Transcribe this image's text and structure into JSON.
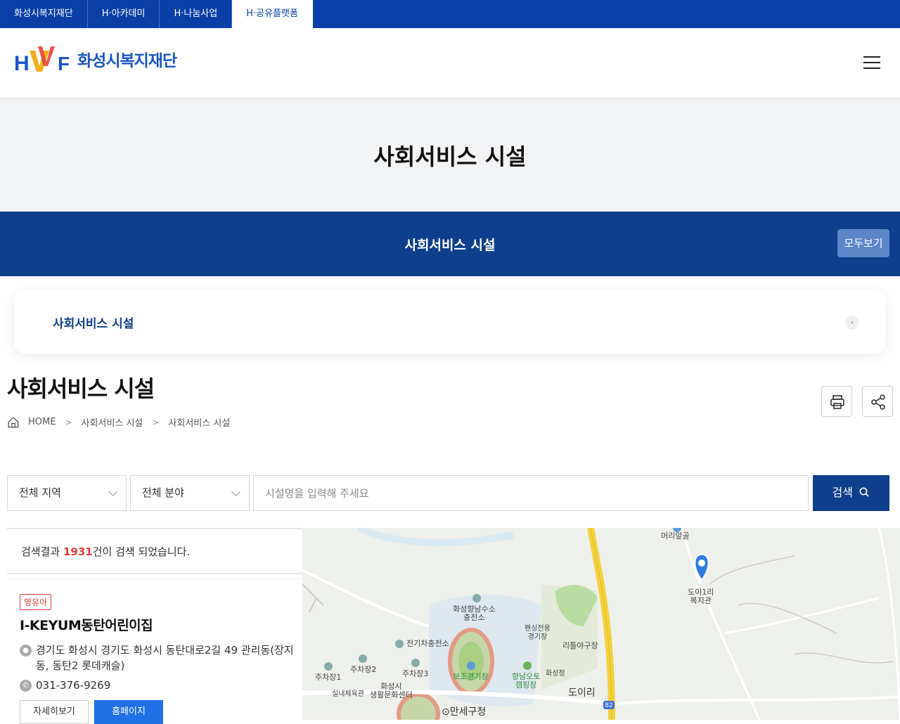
{
  "topbar": {
    "tabs": [
      {
        "label": "화성시복지재단",
        "active": false
      },
      {
        "label": "H·아카데미",
        "active": false
      },
      {
        "label": "H·나눔사업",
        "active": false
      },
      {
        "label": "H·공유플랫폼",
        "active": true
      }
    ]
  },
  "header": {
    "logo_text": "화성시복지재단",
    "menu_icon": "hamburger-icon"
  },
  "hero": {
    "title": "사회서비스 시설"
  },
  "band": {
    "title": "사회서비스 시설",
    "all_button": "모두보기"
  },
  "submenu": {
    "label": "사회서비스 시설"
  },
  "page": {
    "title": "사회서비스 시설",
    "breadcrumb": [
      "HOME",
      "사회서비스 시설",
      "사회서비스 시설"
    ]
  },
  "search": {
    "region_select": "전체 지역",
    "field_select": "전체 분야",
    "placeholder": "시설명을 입력해 주세요",
    "button_label": "검색"
  },
  "results": {
    "count_prefix": "검색결과 ",
    "count": "1931",
    "count_suffix": "건이 검색 되었습니다.",
    "items": [
      {
        "badge": "영유아",
        "name": "I-KEYUM동탄어린이집",
        "address": "경기도 화성시 경기도 화성시 동탄대로2길 49 관리동(장지동, 동탄2 롯데캐슬)",
        "phone": "031-376-9269",
        "detail_button": "자세히보기",
        "home_button": "홈페이지"
      }
    ]
  },
  "map": {
    "labels": {
      "a": "머리앞골",
      "b": "도이1리\n복지관",
      "c": "화성향남수소\n충전소",
      "d": "전기차충전소",
      "e": "펜싱전용\n경기장",
      "f": "리틀야구장",
      "g": "주차장2",
      "h": "주차장1",
      "i": "주차장3",
      "j": "보조경기장",
      "k": "향남오토\n캠핑장",
      "l": "화성정",
      "m": "실내체육관",
      "n": "화성시\n생활문화센터",
      "o": "도이리",
      "p": "⊙만세구청",
      "q": "82"
    }
  },
  "colors": {
    "primary": "#0f3f8c",
    "accent": "#e43b3b",
    "top_bar": "#0a3fa8"
  }
}
